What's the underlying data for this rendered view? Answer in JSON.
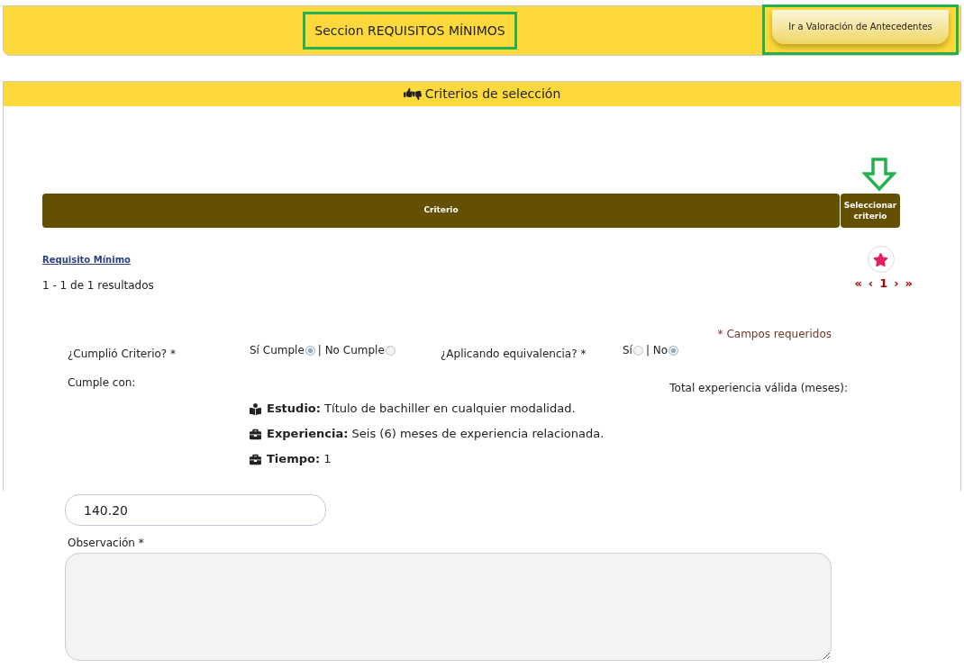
{
  "header": {
    "title": "Seccion REQUISITOS MÍNIMOS",
    "button": "Ir a Valoración de Antecedentes"
  },
  "panel": {
    "title": "Criterios de selección"
  },
  "table": {
    "columns": [
      "Criterio",
      "Seleccionar criterio"
    ]
  },
  "link": "Requisito Mínimo",
  "results": "1 - 1 de 1 resultados",
  "pager": {
    "first": "«",
    "prev": "‹",
    "page": "1",
    "next": "›",
    "last": "»"
  },
  "required_note": "* Campos requeridos",
  "questions": [
    {
      "label": "¿Cumplió Criterio? *",
      "options": [
        {
          "label": "Sí Cumple",
          "selected": true
        },
        {
          "label": "| No Cumple",
          "selected": false
        }
      ]
    },
    {
      "label": "¿Aplicando equivalencia? *",
      "options": [
        {
          "label": "Sí",
          "selected": false
        },
        {
          "label": "| No",
          "selected": true
        }
      ]
    }
  ],
  "cumple_label": "Cumple con:",
  "total_label": "Total experiencia válida (meses):",
  "requirements": [
    {
      "kind": "study",
      "text": "**Estudio:** Título de bachiller en cualquier modalidad."
    },
    {
      "kind": "work",
      "text": "**Experiencia:** Seis (6) meses de experiencia relacionada."
    },
    {
      "kind": "work",
      "text": "**Tiempo:** 1"
    }
  ],
  "total_value": "140.20",
  "observation": {
    "label": "Observación *"
  }
}
